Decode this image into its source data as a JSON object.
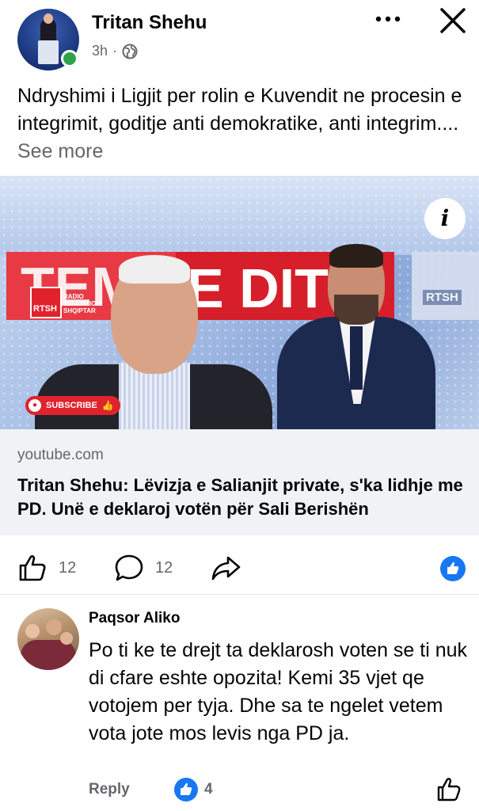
{
  "post": {
    "author": "Tritan Shehu",
    "time": "3h",
    "separator": "·",
    "privacy_icon": "globe-icon",
    "text": "Ndryshimi i Ligjit per rolin e Kuvendit ne procesin e integrimit, goditje anti demokratike, anti integrim.... ",
    "see_more": "See more"
  },
  "media": {
    "banner_left": "TEM",
    "banner_right": "E DITË",
    "channel": "RTSH",
    "channel_caption": "RADIO TELEVIZIONI SHQIPTAR",
    "subscribe_label": "SUBSCRIBE",
    "info_icon": "i"
  },
  "link": {
    "domain": "youtube.com",
    "title": "Tritan Shehu: Lëvizja e Salianjit private, s'ka lidhje me PD. Unë e deklaroj votën për Sali Berishën"
  },
  "actions": {
    "like_count": "12",
    "comment_count": "12"
  },
  "comment": {
    "author": "Paqsor Aliko",
    "text": "Po ti ke te drejt ta deklarosh voten se ti nuk di cfare eshte opozita! Kemi  35 vjet qe votojem per tyja. Dhe sa te ngelet vetem vota jote mos levis nga PD ja.",
    "reply_label": "Reply",
    "reaction_count": "4"
  },
  "colors": {
    "accent": "#1877f2",
    "muted": "#65676b",
    "online": "#31a24c",
    "rtsh_red": "#e0222d"
  }
}
